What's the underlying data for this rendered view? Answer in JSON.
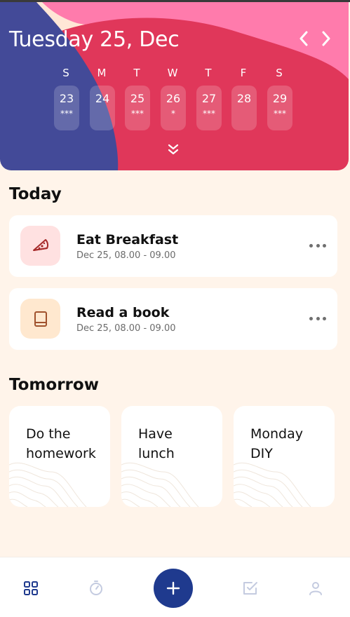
{
  "header": {
    "date_title": "Tuesday 25, Dec",
    "colors": {
      "indigo": "#434a98",
      "crimson": "#e0375a",
      "pink": "#ff7bac",
      "peach": "#ffe6d6"
    },
    "week": [
      {
        "letter": "S",
        "number": "23",
        "dots": "***"
      },
      {
        "letter": "M",
        "number": "24",
        "dots": ""
      },
      {
        "letter": "T",
        "number": "25",
        "dots": "***"
      },
      {
        "letter": "W",
        "number": "26",
        "dots": "*"
      },
      {
        "letter": "T",
        "number": "27",
        "dots": "***"
      },
      {
        "letter": "F",
        "number": "28",
        "dots": ""
      },
      {
        "letter": "S",
        "number": "29",
        "dots": "***"
      }
    ],
    "icons": {
      "prev": "chevron-left-icon",
      "next": "chevron-right-icon",
      "expand": "double-chevron-down-icon"
    }
  },
  "today": {
    "title": "Today",
    "tasks": [
      {
        "title": "Eat Breakfast",
        "time": "Dec 25, 08.00 - 09.00",
        "icon": "pizza-icon",
        "icon_bg": "#ffe1e1",
        "icon_color": "#a52a2a"
      },
      {
        "title": "Read a book",
        "time": "Dec 25, 08.00 - 09.00",
        "icon": "book-icon",
        "icon_bg": "#ffe8cf",
        "icon_color": "#a0522d"
      }
    ]
  },
  "tomorrow": {
    "title": "Tomorrow",
    "cards": [
      {
        "line1": "Do the",
        "line2": "homework"
      },
      {
        "line1": "Have",
        "line2": "lunch"
      },
      {
        "line1": "Monday",
        "line2": "DIY"
      }
    ]
  },
  "bottom_nav": {
    "items": [
      "grid-icon",
      "timer-icon",
      "plus-icon",
      "checkbox-icon",
      "user-icon"
    ],
    "active_color": "#1f3a8e",
    "inactive_color": "#c4cbe0"
  }
}
